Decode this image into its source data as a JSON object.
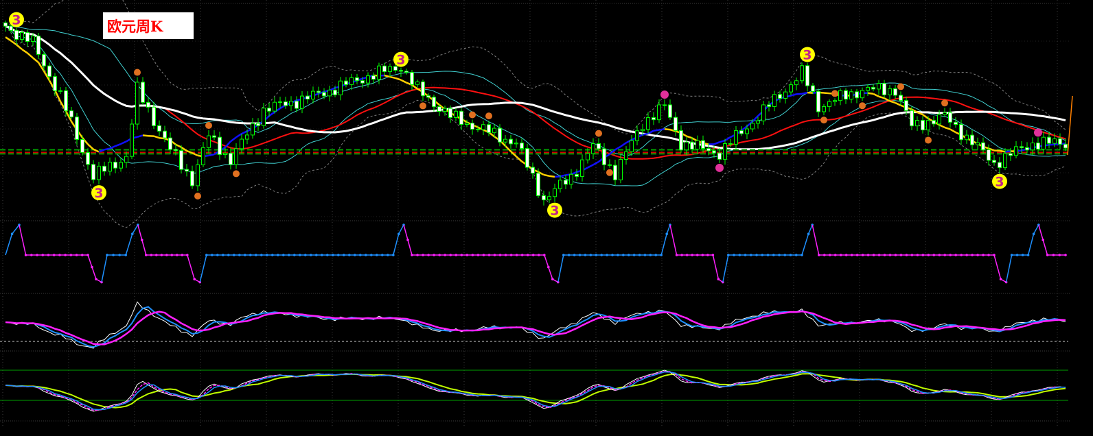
{
  "title": "欧元周K",
  "colors": {
    "bg": "#000000",
    "grid": "#3c3c3c",
    "candle": "#00ff00",
    "ma_long": "#ffffff",
    "ma_mid": "#ff1010",
    "band": "#40d0d0",
    "envelope": "#808080",
    "trend_up": "#1010ff",
    "trend_down": "#ffd000",
    "osc_up": "#1e90ff",
    "osc_down": "#ff20ff",
    "level_green": "#00a000",
    "level_red": "#d00000"
  },
  "chart_data": {
    "type": "candlestick",
    "title": "欧元周K",
    "bars": 194,
    "price_keypoints": [
      [
        0,
        1.239
      ],
      [
        5,
        1.224
      ],
      [
        10,
        1.176
      ],
      [
        16,
        1.104
      ],
      [
        22,
        1.122
      ],
      [
        24,
        1.182
      ],
      [
        30,
        1.128
      ],
      [
        34,
        1.101
      ],
      [
        37,
        1.14
      ],
      [
        41,
        1.119
      ],
      [
        47,
        1.164
      ],
      [
        56,
        1.176
      ],
      [
        66,
        1.194
      ],
      [
        72,
        1.203
      ],
      [
        75,
        1.182
      ],
      [
        81,
        1.158
      ],
      [
        87,
        1.146
      ],
      [
        93,
        1.134
      ],
      [
        98,
        1.083
      ],
      [
        103,
        1.104
      ],
      [
        107,
        1.131
      ],
      [
        111,
        1.107
      ],
      [
        116,
        1.152
      ],
      [
        120,
        1.167
      ],
      [
        123,
        1.134
      ],
      [
        130,
        1.125
      ],
      [
        137,
        1.158
      ],
      [
        145,
        1.197
      ],
      [
        148,
        1.167
      ],
      [
        156,
        1.182
      ],
      [
        162,
        1.182
      ],
      [
        165,
        1.149
      ],
      [
        171,
        1.158
      ],
      [
        180,
        1.116
      ],
      [
        187,
        1.134
      ],
      [
        193,
        1.134
      ]
    ],
    "price_range": [
      1.068,
      1.26
    ],
    "horizontal_levels": [
      {
        "price": 1.128,
        "color": "green"
      },
      {
        "price": 1.1244,
        "color": "green"
      },
      {
        "price": 1.1256,
        "color": "red"
      }
    ],
    "wave_markers": [
      {
        "bar": 2,
        "pos": "top",
        "label": "3"
      },
      {
        "bar": 17,
        "pos": "bottom",
        "label": "3"
      },
      {
        "bar": 72,
        "pos": "top",
        "label": "3"
      },
      {
        "bar": 100,
        "pos": "bottom",
        "label": "3"
      },
      {
        "bar": 146,
        "pos": "top",
        "label": "3"
      },
      {
        "bar": 181,
        "pos": "bottom",
        "label": "3"
      }
    ],
    "minor_markers": [
      {
        "bar": 24,
        "pos": "top"
      },
      {
        "bar": 37,
        "pos": "top"
      },
      {
        "bar": 35,
        "pos": "bottom"
      },
      {
        "bar": 42,
        "pos": "bottom"
      },
      {
        "bar": 76,
        "pos": "bottom"
      },
      {
        "bar": 85,
        "pos": "top"
      },
      {
        "bar": 88,
        "pos": "top"
      },
      {
        "bar": 108,
        "pos": "top"
      },
      {
        "bar": 110,
        "pos": "bottom"
      },
      {
        "bar": 149,
        "pos": "bottom"
      },
      {
        "bar": 151,
        "pos": "top"
      },
      {
        "bar": 156,
        "pos": "bottom"
      },
      {
        "bar": 163,
        "pos": "top"
      },
      {
        "bar": 168,
        "pos": "bottom"
      },
      {
        "bar": 171,
        "pos": "top"
      }
    ],
    "pink_markers": [
      {
        "bar": 120,
        "pos": "top"
      },
      {
        "bar": 130,
        "pos": "bottom"
      },
      {
        "bar": 188,
        "pos": "top"
      }
    ],
    "step_oscillator": [
      [
        0,
        0
      ],
      [
        1.2,
        0.7
      ],
      [
        2.5,
        1
      ],
      [
        3.7,
        0
      ],
      [
        15,
        0
      ],
      [
        16.5,
        -0.8
      ],
      [
        17.5,
        -0.9
      ],
      [
        18.5,
        0
      ],
      [
        21.9,
        0
      ],
      [
        23.1,
        0.7
      ],
      [
        24.1,
        1
      ],
      [
        25.6,
        0
      ],
      [
        33.1,
        0
      ],
      [
        34.4,
        -0.8
      ],
      [
        35.4,
        -0.9
      ],
      [
        36.6,
        0
      ],
      [
        70.6,
        0
      ],
      [
        71.6,
        0.7
      ],
      [
        72.5,
        1
      ],
      [
        74,
        0
      ],
      [
        98.1,
        0
      ],
      [
        99.6,
        -0.8
      ],
      [
        100.6,
        -0.9
      ],
      [
        101.6,
        0
      ],
      [
        119.4,
        0
      ],
      [
        120.4,
        0.7
      ],
      [
        121,
        1
      ],
      [
        122.2,
        0
      ],
      [
        128.8,
        0
      ],
      [
        129.8,
        -0.8
      ],
      [
        130.6,
        -0.9
      ],
      [
        131.6,
        0
      ],
      [
        145,
        0
      ],
      [
        146.2,
        0.7
      ],
      [
        146.9,
        1
      ],
      [
        148.1,
        0
      ],
      [
        180,
        0
      ],
      [
        181.2,
        -0.8
      ],
      [
        182.2,
        -0.9
      ],
      [
        183.2,
        0
      ],
      [
        186.2,
        0
      ],
      [
        187.2,
        0.7
      ],
      [
        188.1,
        1
      ],
      [
        189.7,
        0
      ],
      [
        193,
        0
      ]
    ]
  }
}
